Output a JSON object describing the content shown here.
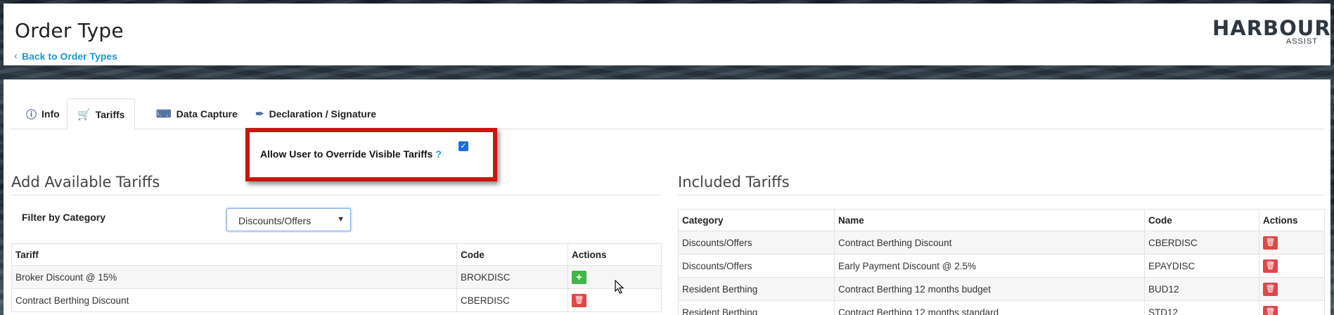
{
  "header": {
    "title": "Order Type",
    "back_link": "Back to Order Types",
    "logo_main": "HARBOUR",
    "logo_sub": "ASSIST"
  },
  "tabs": [
    {
      "label": "Info",
      "icon": "info-icon",
      "active": false
    },
    {
      "label": "Tariffs",
      "icon": "cart-icon",
      "active": true
    },
    {
      "label": "Data Capture",
      "icon": "keyboard-icon",
      "active": false
    },
    {
      "label": "Declaration / Signature",
      "icon": "pen-icon",
      "active": false
    }
  ],
  "override": {
    "label": "Allow User to Override Visible Tariffs",
    "help": "?",
    "checked": true
  },
  "available": {
    "title": "Add Available Tariffs",
    "filter_label": "Filter by Category",
    "filter_value": "Discounts/Offers",
    "columns": [
      "Tariff",
      "Code",
      "Actions"
    ],
    "rows": [
      {
        "tariff": "Broker Discount @ 15%",
        "code": "BROKDISC",
        "action": "add"
      },
      {
        "tariff": "Contract Berthing Discount",
        "code": "CBERDISC",
        "action": "delete"
      }
    ]
  },
  "included": {
    "title": "Included Tariffs",
    "columns": [
      "Category",
      "Name",
      "Code",
      "Actions"
    ],
    "rows": [
      {
        "category": "Discounts/Offers",
        "name": "Contract Berthing Discount",
        "code": "CBERDISC"
      },
      {
        "category": "Discounts/Offers",
        "name": "Early Payment Discount @ 2.5%",
        "code": "EPAYDISC"
      },
      {
        "category": "Resident Berthing",
        "name": "Contract Berthing 12 months budget",
        "code": "BUD12"
      },
      {
        "category": "Resident Berthing",
        "name": "Contract Berthing 12 months standard",
        "code": "STD12"
      }
    ]
  },
  "colors": {
    "accent": "#1a9ad6",
    "highlight_border": "#c8160e",
    "add_button": "#43b649",
    "delete_button": "#e04747"
  }
}
